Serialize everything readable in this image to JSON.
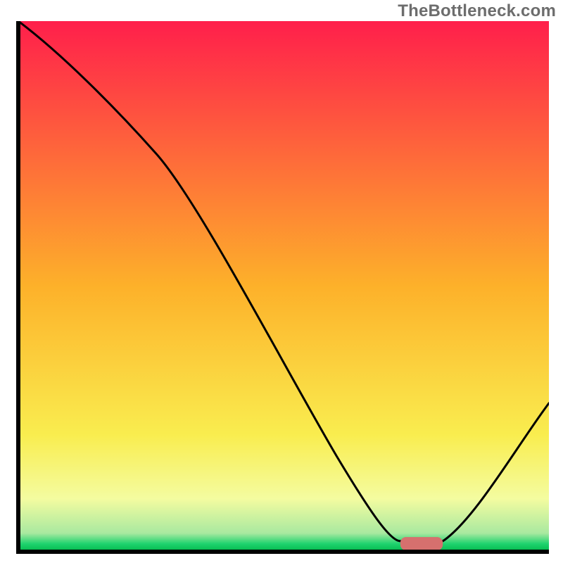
{
  "watermark": "TheBottleneck.com",
  "chart_data": {
    "type": "line",
    "title": "",
    "xlabel": "",
    "ylabel": "",
    "xlim": [
      0,
      100
    ],
    "ylim": [
      0,
      100
    ],
    "x": [
      0,
      13,
      26,
      60,
      72,
      80,
      100
    ],
    "values": [
      100,
      88,
      75,
      18,
      2,
      2,
      28
    ],
    "marker": {
      "x": 76,
      "width": 8,
      "height": 2.5,
      "color": "#d6706e"
    },
    "gradient_stops": [
      {
        "offset": 0.0,
        "color": "#ff1f4b"
      },
      {
        "offset": 0.5,
        "color": "#fdb12a"
      },
      {
        "offset": 0.78,
        "color": "#f9ed4f"
      },
      {
        "offset": 0.9,
        "color": "#f4fca0"
      },
      {
        "offset": 0.965,
        "color": "#a9e9a0"
      },
      {
        "offset": 0.985,
        "color": "#1fd36e"
      },
      {
        "offset": 1.0,
        "color": "#00b64a"
      }
    ],
    "axes_color": "#000000",
    "curve_color": "#000000"
  }
}
